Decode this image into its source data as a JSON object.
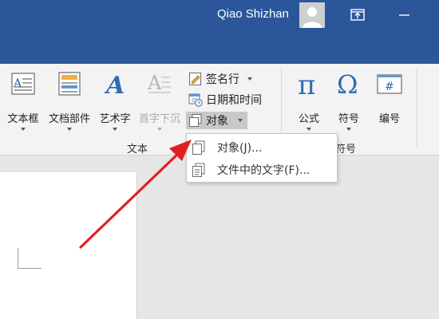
{
  "titlebar": {
    "user_name": "Qiao Shizhan",
    "accent_color": "#2b579a",
    "icons": [
      "avatar-icon",
      "ribbon-display-options-icon",
      "minimize-icon"
    ]
  },
  "ribbon": {
    "text_group": {
      "label": "文本",
      "textbox": "文本框",
      "quick_parts": "文档部件",
      "wordart": "艺术字",
      "dropcap": "首字下沉",
      "signature_line": "签名行",
      "date_time": "日期和时间",
      "object": "对象"
    },
    "symbols_group": {
      "label": "符号",
      "equation": "公式",
      "symbol": "符号",
      "number": "编号"
    }
  },
  "dropdown": {
    "items": [
      {
        "label": "对象(J)...",
        "icon": "object-icon"
      },
      {
        "label": "文件中的文字(F)...",
        "icon": "text-from-file-icon"
      }
    ]
  },
  "annotation": {
    "arrow_color": "#e02020"
  }
}
